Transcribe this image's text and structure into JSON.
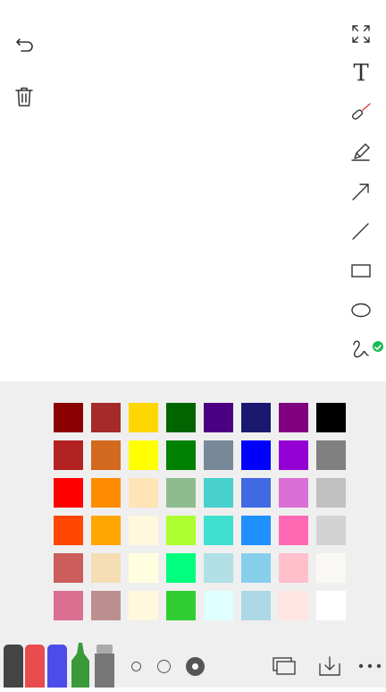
{
  "toolbar_left": {
    "undo_icon": "undo-icon",
    "trash_icon": "trash-icon"
  },
  "toolbar_right": {
    "tools": [
      "fullscreen-icon",
      "text-icon",
      "laser-pointer-icon",
      "highlighter-icon",
      "arrow-icon",
      "line-icon",
      "rectangle-icon",
      "ellipse-icon",
      "freehand-icon"
    ],
    "text_tool_label": "T",
    "selected_tool": "freehand"
  },
  "colors": {
    "accent": "#1db954",
    "palette": [
      [
        "#8b0000",
        "#a52a2a",
        "#ffd700",
        "#006400",
        "#4b0082",
        "#191970",
        "#800080",
        "#000000"
      ],
      [
        "#b22222",
        "#d2691e",
        "#ffff00",
        "#008000",
        "#778899",
        "#0000ff",
        "#9400d3",
        "#808080"
      ],
      [
        "#ff0000",
        "#ff8c00",
        "#ffe4b5",
        "#8fbc8f",
        "#48d1cc",
        "#4169e1",
        "#da70d6",
        "#c0c0c0"
      ],
      [
        "#ff4500",
        "#ffa500",
        "#fff8dc",
        "#adff2f",
        "#40e0d0",
        "#1e90ff",
        "#ff69b4",
        "#d3d3d3"
      ],
      [
        "#cd5c5c",
        "#f5deb3",
        "#ffffe0",
        "#00ff7f",
        "#b0e0e6",
        "#87ceeb",
        "#ffc0cb",
        "#faf8f5"
      ],
      [
        "#db7093",
        "#bc8f8f",
        "#fff8dc",
        "#32cd32",
        "#e0ffff",
        "#add8e6",
        "#ffe4e1",
        "#ffffff"
      ]
    ]
  },
  "pens": [
    "#444444",
    "#e84c4c",
    "#4c4ce8",
    "#3a9a3a",
    "#777777"
  ],
  "sizes": [
    "small",
    "medium",
    "large"
  ],
  "selected_size": "large"
}
